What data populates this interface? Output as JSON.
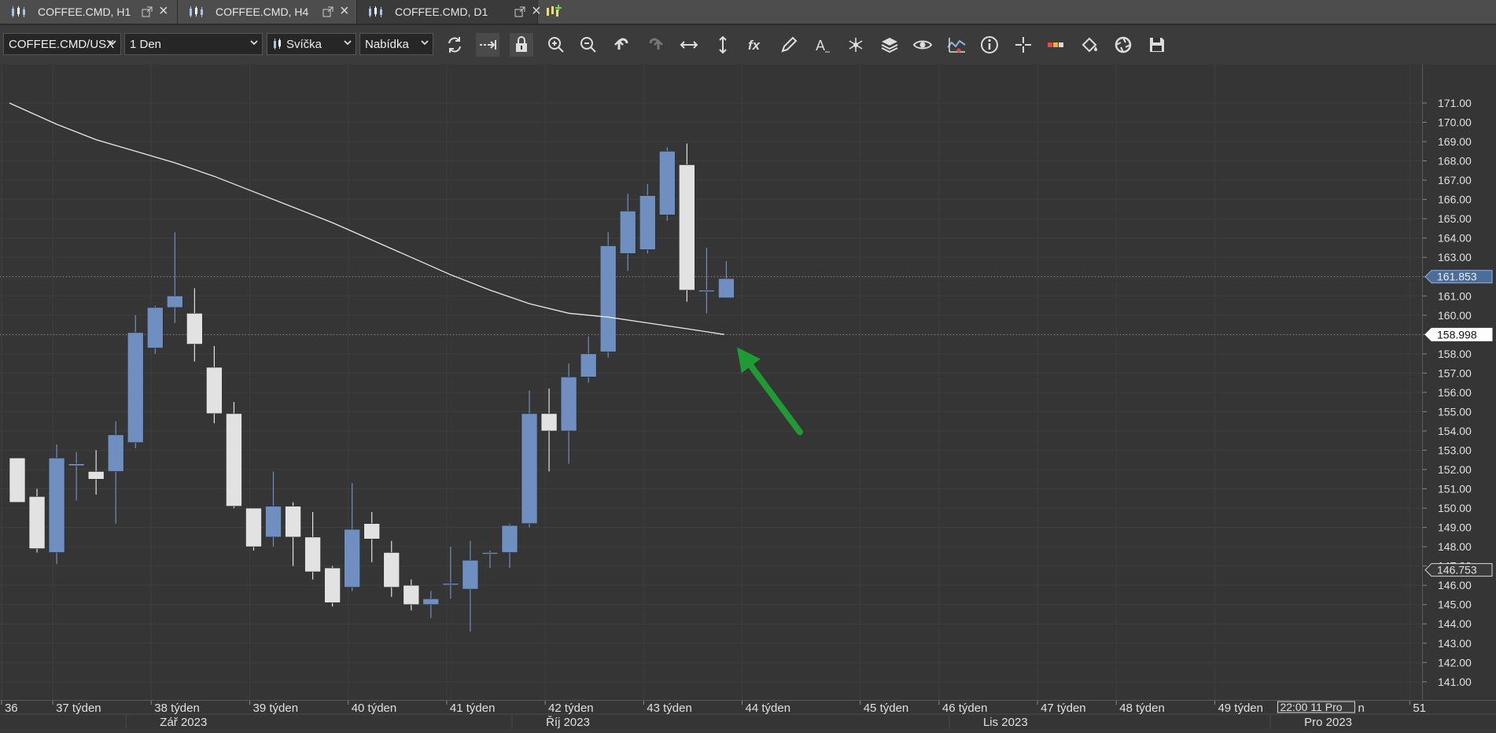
{
  "tabs": [
    {
      "label": "COFFEE.CMD, H1",
      "active": false
    },
    {
      "label": "COFFEE.CMD, H4",
      "active": false
    },
    {
      "label": "COFFEE.CMD, D1",
      "active": true
    }
  ],
  "toolbar": {
    "symbol": "COFFEE.CMD/USX",
    "timeframe": "1 Den",
    "chart_type": "Svíčka",
    "price_type": "Nabídka",
    "icons": [
      "refresh-icon",
      "autoscroll-icon",
      "lock-icon",
      "zoom-in-icon",
      "zoom-out-icon",
      "undo-icon",
      "redo-icon",
      "horizontal-scale-icon",
      "vertical-scale-icon",
      "indicator-fx-icon",
      "pencil-draw-icon",
      "text-tool-icon",
      "pattern-tool-icon",
      "layers-icon",
      "eye-icon",
      "signals-icon",
      "info-icon",
      "crosshair-icon",
      "color-scheme-icon",
      "paint-bucket-icon",
      "snapshot-icon",
      "save-icon"
    ]
  },
  "chart_data": {
    "type": "candlestick",
    "ylim": [
      140.3,
      172.1
    ],
    "price_ticks": [
      "171.00",
      "170.00",
      "169.00",
      "168.00",
      "167.00",
      "166.00",
      "165.00",
      "164.00",
      "163.00",
      "162.00",
      "161.00",
      "160.00",
      "159.00",
      "158.00",
      "157.00",
      "156.00",
      "155.00",
      "154.00",
      "153.00",
      "152.00",
      "151.00",
      "150.00",
      "149.00",
      "148.00",
      "147.00",
      "146.00",
      "145.00",
      "144.00",
      "143.00",
      "142.00",
      "141.00"
    ],
    "bar_spacing": 25.04,
    "bull_color": "#6f8fc0",
    "bear_color": "#e2e2e2",
    "candles": [
      {
        "o": 152.6,
        "h": 152.6,
        "l": 150.3,
        "c": 150.3
      },
      {
        "o": 150.6,
        "h": 151.0,
        "l": 147.7,
        "c": 147.9
      },
      {
        "o": 147.7,
        "h": 153.3,
        "l": 147.1,
        "c": 152.6
      },
      {
        "o": 152.2,
        "h": 152.9,
        "l": 150.4,
        "c": 152.3
      },
      {
        "o": 151.9,
        "h": 153.0,
        "l": 150.7,
        "c": 151.5
      },
      {
        "o": 151.9,
        "h": 154.5,
        "l": 149.2,
        "c": 153.8
      },
      {
        "o": 153.4,
        "h": 160.0,
        "l": 153.1,
        "c": 159.1
      },
      {
        "o": 158.3,
        "h": 160.5,
        "l": 158.0,
        "c": 160.4
      },
      {
        "o": 160.4,
        "h": 164.3,
        "l": 159.6,
        "c": 161.0
      },
      {
        "o": 160.1,
        "h": 161.4,
        "l": 157.6,
        "c": 158.5
      },
      {
        "o": 157.3,
        "h": 158.4,
        "l": 154.4,
        "c": 154.9
      },
      {
        "o": 154.9,
        "h": 155.5,
        "l": 150.0,
        "c": 150.1
      },
      {
        "o": 150.0,
        "h": 150.0,
        "l": 147.8,
        "c": 148.0
      },
      {
        "o": 148.5,
        "h": 151.9,
        "l": 148.0,
        "c": 150.1
      },
      {
        "o": 150.1,
        "h": 150.3,
        "l": 147.0,
        "c": 148.5
      },
      {
        "o": 148.5,
        "h": 149.8,
        "l": 146.3,
        "c": 146.7
      },
      {
        "o": 146.9,
        "h": 147.0,
        "l": 144.9,
        "c": 145.1
      },
      {
        "o": 145.9,
        "h": 151.3,
        "l": 145.7,
        "c": 148.9
      },
      {
        "o": 149.2,
        "h": 149.8,
        "l": 147.2,
        "c": 148.4
      },
      {
        "o": 147.7,
        "h": 148.3,
        "l": 145.4,
        "c": 145.9
      },
      {
        "o": 146.0,
        "h": 146.3,
        "l": 144.7,
        "c": 145.0
      },
      {
        "o": 145.0,
        "h": 145.7,
        "l": 144.3,
        "c": 145.3
      },
      {
        "o": 146.1,
        "h": 148.0,
        "l": 145.3,
        "c": 146.1
      },
      {
        "o": 145.8,
        "h": 148.3,
        "l": 143.6,
        "c": 147.3
      },
      {
        "o": 147.7,
        "h": 147.8,
        "l": 146.9,
        "c": 147.7
      },
      {
        "o": 147.7,
        "h": 149.2,
        "l": 146.9,
        "c": 149.1
      },
      {
        "o": 149.2,
        "h": 156.1,
        "l": 149.0,
        "c": 154.9
      },
      {
        "o": 154.9,
        "h": 156.2,
        "l": 151.9,
        "c": 154.0
      },
      {
        "o": 154.0,
        "h": 157.5,
        "l": 152.3,
        "c": 156.8
      },
      {
        "o": 156.8,
        "h": 158.9,
        "l": 156.5,
        "c": 158.0
      },
      {
        "o": 158.1,
        "h": 164.3,
        "l": 157.8,
        "c": 163.6
      },
      {
        "o": 163.2,
        "h": 166.3,
        "l": 162.3,
        "c": 165.4
      },
      {
        "o": 163.4,
        "h": 166.8,
        "l": 163.2,
        "c": 166.2
      },
      {
        "o": 165.2,
        "h": 168.7,
        "l": 164.9,
        "c": 168.5
      },
      {
        "o": 167.8,
        "h": 168.9,
        "l": 160.7,
        "c": 161.3
      },
      {
        "o": 161.3,
        "h": 163.5,
        "l": 160.1,
        "c": 161.3
      },
      {
        "o": 160.9,
        "h": 162.8,
        "l": 160.9,
        "c": 161.9
      }
    ],
    "moving_average": [
      {
        "i": -0.4,
        "v": 171.0
      },
      {
        "i": 2,
        "v": 169.9
      },
      {
        "i": 4,
        "v": 169.1
      },
      {
        "i": 6,
        "v": 168.5
      },
      {
        "i": 8,
        "v": 167.9
      },
      {
        "i": 10,
        "v": 167.2
      },
      {
        "i": 12,
        "v": 166.4
      },
      {
        "i": 14,
        "v": 165.6
      },
      {
        "i": 16,
        "v": 164.8
      },
      {
        "i": 18,
        "v": 163.9
      },
      {
        "i": 20,
        "v": 163.0
      },
      {
        "i": 22,
        "v": 162.1
      },
      {
        "i": 24,
        "v": 161.3
      },
      {
        "i": 26,
        "v": 160.6
      },
      {
        "i": 28,
        "v": 160.1
      },
      {
        "i": 30,
        "v": 159.9
      },
      {
        "i": 32,
        "v": 159.6
      },
      {
        "i": 34,
        "v": 159.3
      },
      {
        "i": 35.9,
        "v": 159.0
      }
    ],
    "horizontal_lines": [
      162.0,
      159.0
    ],
    "price_badges": [
      {
        "text": "161.853",
        "v": 162.0,
        "style": "bid"
      },
      {
        "text": "158.998",
        "v": 159.0,
        "style": "ma"
      },
      {
        "text": "146.753",
        "v": 146.8,
        "style": "low"
      }
    ],
    "week_labels": [
      {
        "text": "36",
        "i": -0.4
      },
      {
        "text": "37 týden",
        "i": 2.2
      },
      {
        "text": "38 týden",
        "i": 7.2
      },
      {
        "text": "39 týden",
        "i": 12.2
      },
      {
        "text": "40 týden",
        "i": 17.2
      },
      {
        "text": "41 týden",
        "i": 22.2
      },
      {
        "text": "42 týden",
        "i": 27.2
      },
      {
        "text": "43 týden",
        "i": 32.2
      },
      {
        "text": "44 týden",
        "i": 37.2
      },
      {
        "text": "45 týden",
        "i": 43.2
      },
      {
        "text": "46 týden",
        "i": 47.2
      },
      {
        "text": "47 týden",
        "i": 52.2
      },
      {
        "text": "48 týden",
        "i": 56.2
      },
      {
        "text": "49 týden",
        "i": 61.2
      },
      {
        "text": "51",
        "i": 71.1
      }
    ],
    "month_labels": [
      {
        "text": "Zář 2023",
        "i": 7.8
      },
      {
        "text": "Říj 2023",
        "i": 27.4
      },
      {
        "text": "Lis 2023",
        "i": 49.6
      },
      {
        "text": "Pro 2023",
        "i": 65.9
      }
    ],
    "cursor_label": "22:00 11 Pro",
    "cursor_suffix": "n",
    "arrow": {
      "color": "#1f9a34"
    }
  }
}
